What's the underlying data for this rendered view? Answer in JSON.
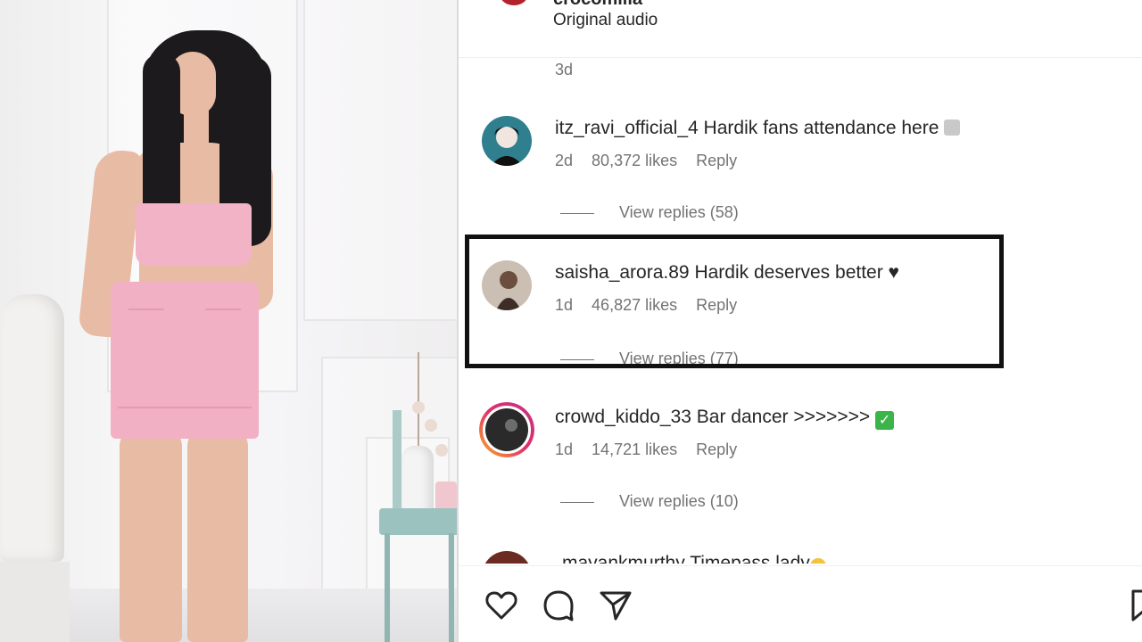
{
  "header": {
    "username_cut": "crocomilia",
    "audio": "Original audio"
  },
  "caption": {
    "time": "3d"
  },
  "comments": [
    {
      "username": "itz_ravi_official_4",
      "text": "Hardik fans attendance here",
      "time": "2d",
      "likes": "80,372 likes",
      "reply": "Reply",
      "view_replies": "View replies (58)",
      "avatar_icon": "anime-avatar-icon"
    },
    {
      "username": "saisha_arora.89",
      "text": "Hardik deserves better ♥",
      "time": "1d",
      "likes": "46,827 likes",
      "reply": "Reply",
      "view_replies": "View replies (77)",
      "avatar_icon": "user-photo-avatar"
    },
    {
      "username": "crowd_kiddo_33",
      "text": "Bar dancer >>>>>>>",
      "time": "1d",
      "likes": "14,721 likes",
      "reply": "Reply",
      "view_replies": "View replies (10)",
      "avatar_icon": "story-ring-avatar"
    },
    {
      "username": "mayankmurthy",
      "text": "Timepass lady"
    }
  ],
  "actions": {
    "like_icon": "heart-icon",
    "comment_icon": "comment-icon",
    "share_icon": "send-icon",
    "save_icon": "bookmark-icon"
  },
  "colors": {
    "highlight_border": "#111111",
    "muted_text": "#737373",
    "skirt": "#f1b0c3",
    "check_green": "#3bb44a"
  }
}
